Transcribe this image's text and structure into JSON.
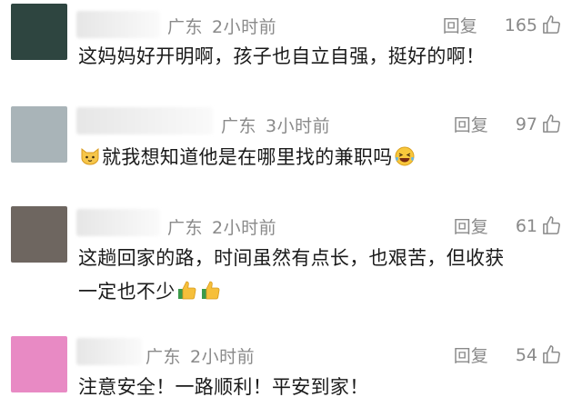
{
  "comments": [
    {
      "location": "广东",
      "time": "2小时前",
      "reply_label": "回复",
      "likes": "165",
      "text": "这妈妈好开明啊，孩子也自立自强，挺好的啊！",
      "avatar_color": "#2e4540"
    },
    {
      "location": "广东",
      "time": "3小时前",
      "reply_label": "回复",
      "likes": "97",
      "text_after_emoji": "就我想知道他是在哪里找的兼职吗",
      "avatar_color": "#a9b4b8",
      "emojis": [
        "cat-face-icon",
        "laughing-tears-icon"
      ]
    },
    {
      "location": "广东",
      "time": "2小时前",
      "reply_label": "回复",
      "likes": "61",
      "text_line1": "这趟回家的路，时间虽然有点长，也艰苦，但收获",
      "text_line2": "一定也不少",
      "avatar_color": "#6e6660",
      "emojis": [
        "thumbs-up-icon",
        "thumbs-up-icon"
      ]
    },
    {
      "location": "广东",
      "time": "2小时前",
      "reply_label": "回复",
      "likes": "54",
      "text": "注意安全！一路顺利！平安到家！",
      "avatar_color": "#e88ac4"
    }
  ],
  "colors": {
    "meta_text": "#8a8a8a",
    "body_text": "#1a1a1a"
  }
}
